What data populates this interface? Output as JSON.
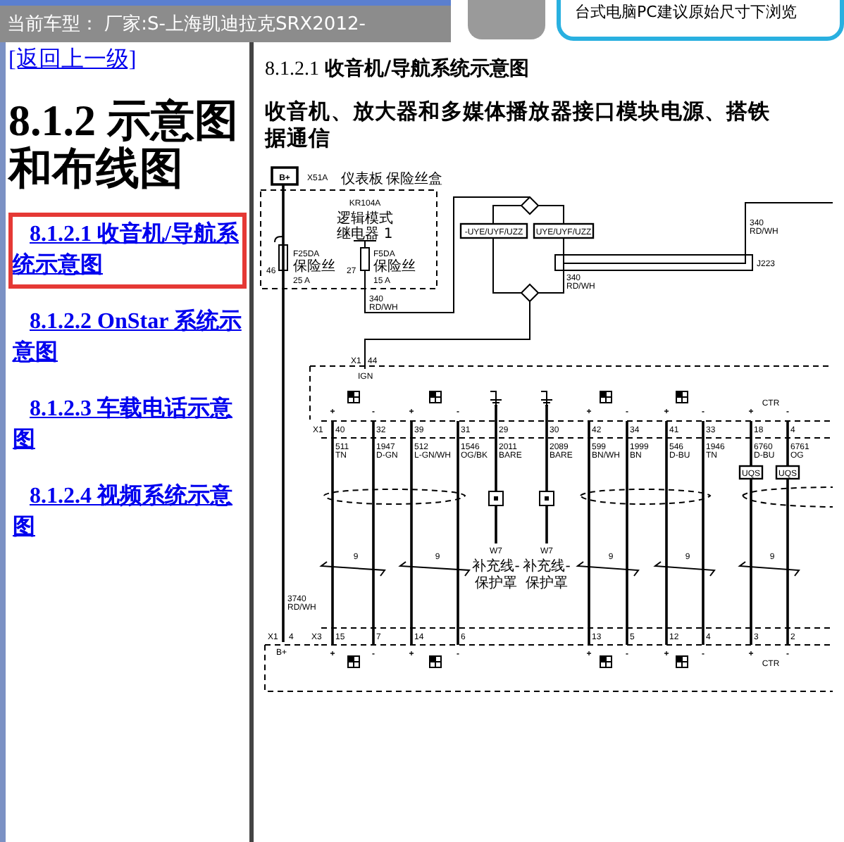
{
  "banner": {
    "vehicle": "当前车型： 厂家:S-上海凯迪拉克SRX2012-",
    "notice": "台式电脑PC建议原始尺寸下浏览"
  },
  "sidebar": {
    "back_link": "[返回上一级]",
    "heading": "8.1.2 示意图和布线图",
    "links": [
      {
        "label": "8.1.2.1 收音机/导航系统示意图",
        "selected": true
      },
      {
        "label": "8.1.2.2 OnStar 系统示意图",
        "selected": false
      },
      {
        "label": "8.1.2.3 车载电话示意图",
        "selected": false
      },
      {
        "label": "8.1.2.4 视频系统示意图",
        "selected": false
      }
    ]
  },
  "content": {
    "section_number": "8.1.2.1",
    "section_title": "收音机/导航系统示意图",
    "subtitle_lines": [
      "收音机、放大器和多媒体播放器接口模块电源、搭铁",
      "据通信"
    ],
    "diagram": {
      "power": "B+",
      "fuse_block": [
        "X51A",
        "仪表板",
        "保险丝盒"
      ],
      "relay": [
        "KR104A",
        "逻辑模式",
        "继电器 1"
      ],
      "fuses": [
        {
          "pin": "46",
          "name": "F25DA",
          "type": "保险丝",
          "rating": "25 A"
        },
        {
          "pin": "27",
          "name": "F5DA",
          "type": "保险丝",
          "rating": "15 A"
        }
      ],
      "circuits": [
        {
          "number": "340",
          "wire_code": "RD/WH"
        },
        {
          "number": "340",
          "wire_code": "RD/WH"
        },
        {
          "number": "340",
          "wire_code": "RD/WH"
        },
        {
          "number": "3740",
          "wire_code": "RD/WH"
        }
      ],
      "options": [
        "-UYE/UYF/UZZ",
        "UYE/UYF/UZZ"
      ],
      "splice": "J223",
      "ignition": {
        "connector": "X1",
        "pin": "44",
        "label": "IGN"
      },
      "top_connector": "X1",
      "ctr_labels": [
        "CTR",
        "CTR"
      ],
      "bottom_connectors": [
        {
          "name": "X1",
          "pin": "4",
          "label": "B+"
        },
        {
          "name": "X3"
        }
      ],
      "wires": [
        {
          "kind": "signal",
          "pin": "40",
          "number": "511",
          "wire_code": "TN",
          "sign": "+",
          "bottom_pin": "15"
        },
        {
          "kind": "signal",
          "pin": "32",
          "number": "1947",
          "wire_code": "D-GN",
          "sign": "-",
          "bottom_pin": "7"
        },
        {
          "kind": "signal",
          "pin": "39",
          "number": "512",
          "wire_code": "L-GN/WH",
          "sign": "+",
          "bottom_pin": "14"
        },
        {
          "kind": "signal",
          "pin": "31",
          "number": "1546",
          "wire_code": "OG/BK",
          "sign": "-",
          "bottom_pin": "6"
        },
        {
          "kind": "drain",
          "pin": "29",
          "number": "2011",
          "wire_code": "BARE",
          "shield": [
            "W7",
            "补充线-",
            "保护罩"
          ]
        },
        {
          "kind": "drain",
          "pin": "30",
          "number": "2089",
          "wire_code": "BARE",
          "shield": [
            "W7",
            "补充线-",
            "保护罩"
          ]
        },
        {
          "kind": "signal",
          "pin": "42",
          "number": "599",
          "wire_code": "BN/WH",
          "sign": "+",
          "bottom_pin": "13"
        },
        {
          "kind": "signal",
          "pin": "34",
          "number": "1999",
          "wire_code": "BN",
          "sign": "-",
          "bottom_pin": "5"
        },
        {
          "kind": "signal",
          "pin": "41",
          "number": "546",
          "wire_code": "D-BU",
          "sign": "+",
          "bottom_pin": "12"
        },
        {
          "kind": "signal",
          "pin": "33",
          "number": "1946",
          "wire_code": "TN",
          "sign": "-",
          "bottom_pin": "4"
        },
        {
          "kind": "signal",
          "pin": "18",
          "number": "6760",
          "wire_code": "D-BU",
          "sign": "+",
          "bottom_pin": "3",
          "filter": "UQS"
        },
        {
          "kind": "signal",
          "pin": "4",
          "number": "6761",
          "wire_code": "OG",
          "sign": "-",
          "bottom_pin": "2",
          "filter": "UQS"
        }
      ],
      "twist_labels": [
        "9",
        "9",
        "9",
        "9",
        "9"
      ]
    }
  }
}
